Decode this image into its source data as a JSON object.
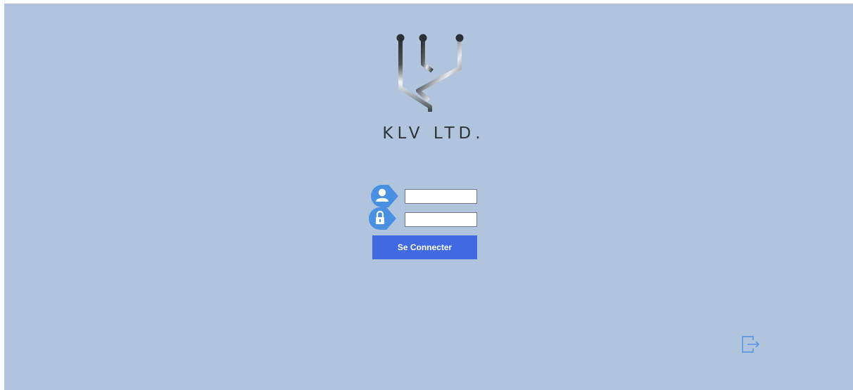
{
  "login": {
    "brand_name": "KLV LTD.",
    "username_value": "",
    "password_value": "",
    "connect_label": "Se Connecter"
  },
  "icons": {
    "logo": "klv-trident-logo-icon",
    "user": "user-icon",
    "lock": "lock-icon",
    "exit": "exit-icon"
  },
  "colors": {
    "background": "#b0c4de",
    "button": "#4169e1",
    "icon_badge": "#4a90e2",
    "brand_text": "#2f3438"
  }
}
